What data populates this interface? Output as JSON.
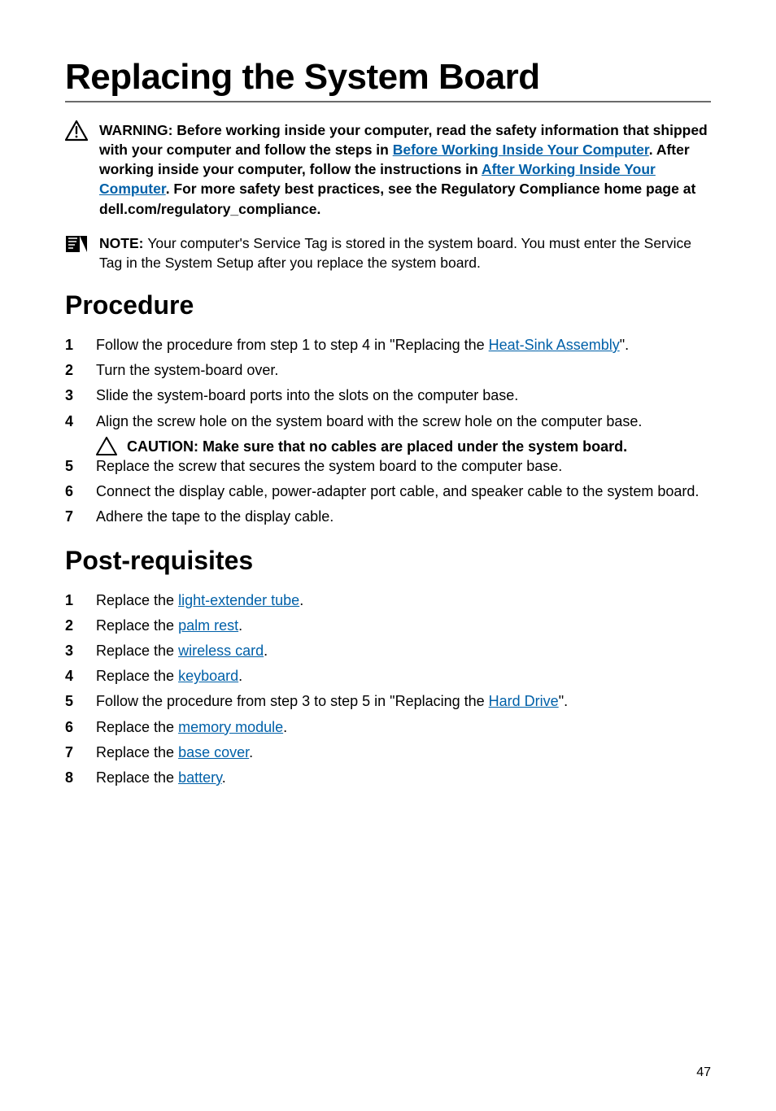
{
  "title": "Replacing the System Board",
  "warning": {
    "prefix": "WARNING: ",
    "p1": "Before working inside your computer, read the safety information that shipped with your computer and follow the steps in ",
    "link1": "Before Working Inside Your Computer",
    "p2": ". After working inside your computer, follow the instructions in ",
    "link2": "After Working Inside Your Computer",
    "p3": ". For more safety best practices, see the Regulatory Compliance home page at dell.com/regulatory_compliance."
  },
  "note": {
    "prefix": "NOTE: ",
    "body": "Your computer's Service Tag is stored in the system board. You must enter the Service Tag in the System Setup after you replace the system board."
  },
  "procedure_heading": "Procedure",
  "procedure": [
    {
      "pre": "Follow the procedure from step 1 to step 4 in \"Replacing the ",
      "link": "Heat-Sink Assembly",
      "post": "\"."
    },
    {
      "text": "Turn the system-board over."
    },
    {
      "text": "Slide the system-board ports into the slots on the computer base."
    },
    {
      "text": "Align the screw hole on the system board with the screw hole on the computer base."
    }
  ],
  "caution": {
    "prefix": "CAUTION: ",
    "body": "Make sure that no cables are placed under the system board."
  },
  "procedure2": [
    {
      "text": "Replace the screw that secures the system board to the computer base."
    },
    {
      "text": "Connect the display cable, power-adapter port cable, and speaker cable to the system board."
    },
    {
      "text": "Adhere the tape to the display cable."
    }
  ],
  "post_heading": "Post-requisites",
  "post": [
    {
      "pre": "Replace the ",
      "link": "light-extender tube",
      "post": "."
    },
    {
      "pre": "Replace the ",
      "link": "palm rest",
      "post": "."
    },
    {
      "pre": "Replace the ",
      "link": "wireless card",
      "post": "."
    },
    {
      "pre": "Replace the ",
      "link": "keyboard",
      "post": "."
    },
    {
      "pre": "Follow the procedure from step 3 to step 5 in \"Replacing the ",
      "link": "Hard Drive",
      "post": "\"."
    },
    {
      "pre": "Replace the ",
      "link": "memory module",
      "post": "."
    },
    {
      "pre": "Replace the ",
      "link": "base cover",
      "post": "."
    },
    {
      "pre": "Replace the ",
      "link": "battery",
      "post": "."
    }
  ],
  "page_number": "47"
}
